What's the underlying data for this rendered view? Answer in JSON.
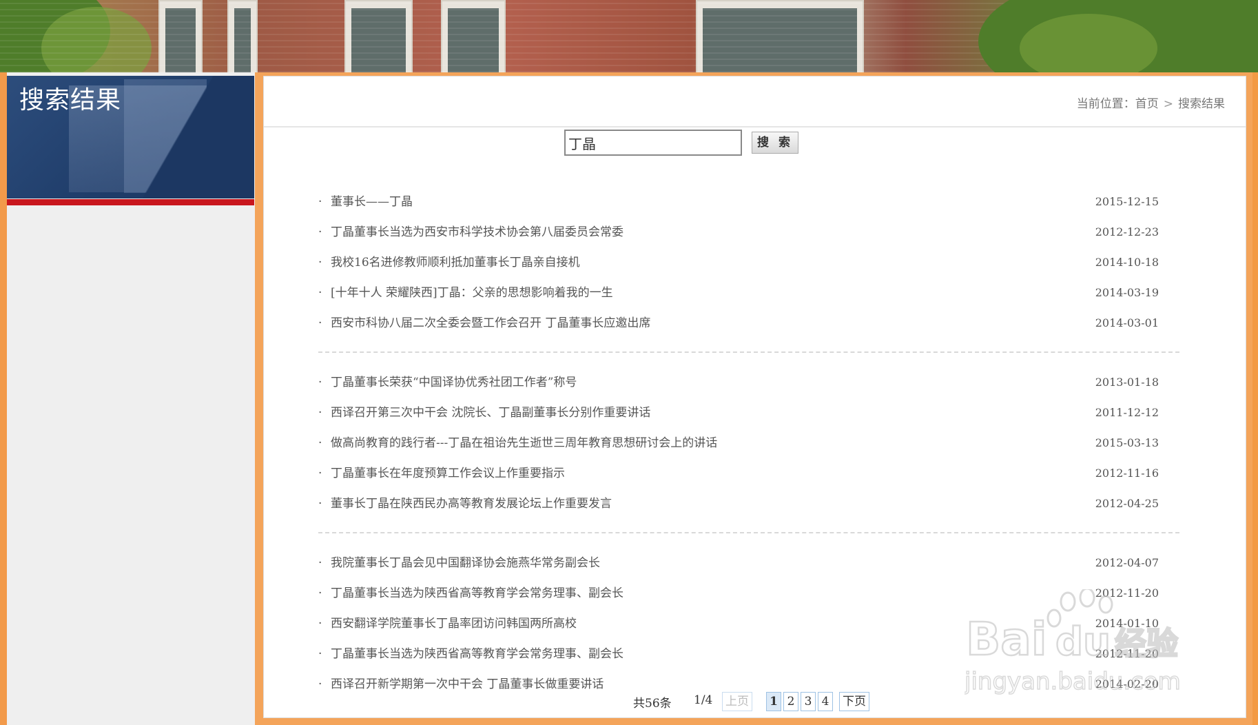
{
  "side": {
    "title": "搜索结果"
  },
  "breadcrumb": {
    "label": "当前位置：",
    "home": "首页",
    "current": "搜索结果",
    "sep": ">"
  },
  "search": {
    "value": "丁晶",
    "button_label": "搜 索"
  },
  "results": [
    [
      {
        "title": "董事长——丁晶",
        "date": "2015-12-15"
      },
      {
        "title": "丁晶董事长当选为西安市科学技术协会第八届委员会常委",
        "date": "2012-12-23"
      },
      {
        "title": "我校16名进修教师顺利抵加董事长丁晶亲自接机",
        "date": "2014-10-18"
      },
      {
        "title": "[十年十人 荣耀陕西]丁晶：父亲的思想影响着我的一生",
        "date": "2014-03-19"
      },
      {
        "title": "西安市科协八届二次全委会暨工作会召开 丁晶董事长应邀出席",
        "date": "2014-03-01"
      }
    ],
    [
      {
        "title": "丁晶董事长荣获“中国译协优秀社团工作者”称号",
        "date": "2013-01-18"
      },
      {
        "title": "西译召开第三次中干会  沈院长、丁晶副董事长分别作重要讲话",
        "date": "2011-12-12"
      },
      {
        "title": "做高尚教育的践行者---丁晶在祖诒先生逝世三周年教育思想研讨会上的讲话",
        "date": "2015-03-13"
      },
      {
        "title": "丁晶董事长在年度预算工作会议上作重要指示",
        "date": "2012-11-16"
      },
      {
        "title": "董事长丁晶在陕西民办高等教育发展论坛上作重要发言",
        "date": "2012-04-25"
      }
    ],
    [
      {
        "title": "我院董事长丁晶会见中国翻译协会施燕华常务副会长",
        "date": "2012-04-07"
      },
      {
        "title": "丁晶董事长当选为陕西省高等教育学会常务理事、副会长",
        "date": "2012-11-20"
      },
      {
        "title": "西安翻译学院董事长丁晶率团访问韩国两所高校",
        "date": "2014-01-10"
      },
      {
        "title": "丁晶董事长当选为陕西省高等教育学会常务理事、副会长",
        "date": "2012-11-20"
      },
      {
        "title": "西译召开新学期第一次中干会 丁晶董事长做重要讲话",
        "date": "2014-02-20"
      }
    ]
  ],
  "pager": {
    "count": "共56条",
    "position": "1/4",
    "prev": "上页",
    "pages": [
      "1",
      "2",
      "3",
      "4"
    ],
    "current": "1",
    "next": "下页"
  },
  "watermark": {
    "brand": "Bai",
    "brand2": "du",
    "cn": "经验",
    "url": "jingyan.baidu.com"
  }
}
